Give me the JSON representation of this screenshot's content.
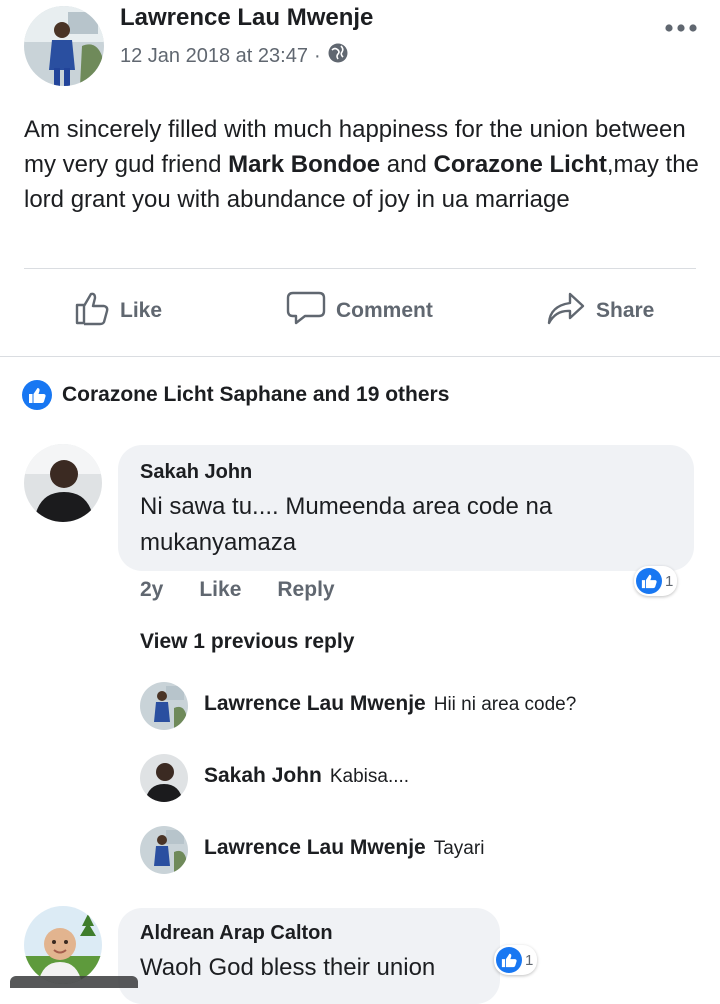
{
  "post": {
    "author": "Lawrence Lau Mwenje",
    "timestamp": "12 Jan 2018 at 23:47",
    "separator": "·",
    "privacy_icon": "globe-icon",
    "more_icon": "more-icon",
    "text_part1": "Am sincerely filled with much happiness for the union between my very gud friend ",
    "mention1": "Mark Bondoe",
    "text_part2": " and ",
    "mention2": "Corazone Licht",
    "text_part3": ",may the lord grant you with abundance of joy in ua marriage"
  },
  "actions": {
    "like": "Like",
    "comment": "Comment",
    "share": "Share"
  },
  "reactions": {
    "summary": "Corazone Licht Saphane and 19 others"
  },
  "comments": [
    {
      "name": "Sakah John",
      "text": "Ni sawa tu.... Mumeenda area code na mukanyamaza",
      "age": "2y",
      "like": "Like",
      "reply": "Reply",
      "like_count": "1"
    },
    {
      "name": "Aldrean Arap Calton",
      "text": "Waoh God bless their union",
      "like_count": "1"
    }
  ],
  "view_previous": "View 1 previous reply",
  "replies": [
    {
      "name": "Lawrence Lau Mwenje",
      "text": "Hii ni area code?"
    },
    {
      "name": "Sakah John",
      "text": "Kabisa...."
    },
    {
      "name": "Lawrence Lau Mwenje",
      "text": "Tayari"
    }
  ],
  "colors": {
    "facebook_blue": "#1877f2",
    "bubble_bg": "#f0f2f5",
    "meta_gray": "#606770",
    "text": "#1c1e21"
  }
}
